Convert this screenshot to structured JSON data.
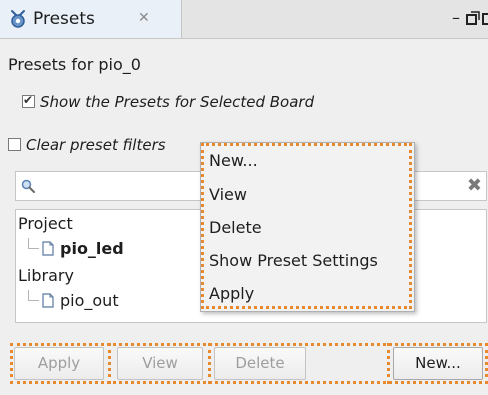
{
  "tab": {
    "title": "Presets",
    "close_glyph": "✕",
    "minimize_glyph": "–",
    "icons": [
      "presets-icon",
      "close-icon",
      "minimize-icon",
      "restore-icon",
      "maximize-icon"
    ]
  },
  "presets_label": "Presets for pio_0",
  "show_selected": {
    "label": "Show the Presets for Selected Board",
    "checked": true,
    "tick": "✔"
  },
  "clear_filters": {
    "label": "Clear preset filters",
    "checked": false
  },
  "search": {
    "value": "",
    "placeholder": "",
    "clear_glyph": "✖"
  },
  "tree": {
    "project_label": "Project",
    "project_items": [
      "pio_led"
    ],
    "library_label": "Library",
    "library_items": [
      "pio_out"
    ]
  },
  "context_menu": {
    "items": [
      "New...",
      "View",
      "Delete",
      "Show Preset Settings",
      "Apply"
    ]
  },
  "buttons": {
    "apply": "Apply",
    "view": "View",
    "delete": "Delete",
    "new": "New..."
  },
  "colors": {
    "highlight": "#e78a2f",
    "panel": "#efefef",
    "tab_active": "#eaf0f8"
  }
}
